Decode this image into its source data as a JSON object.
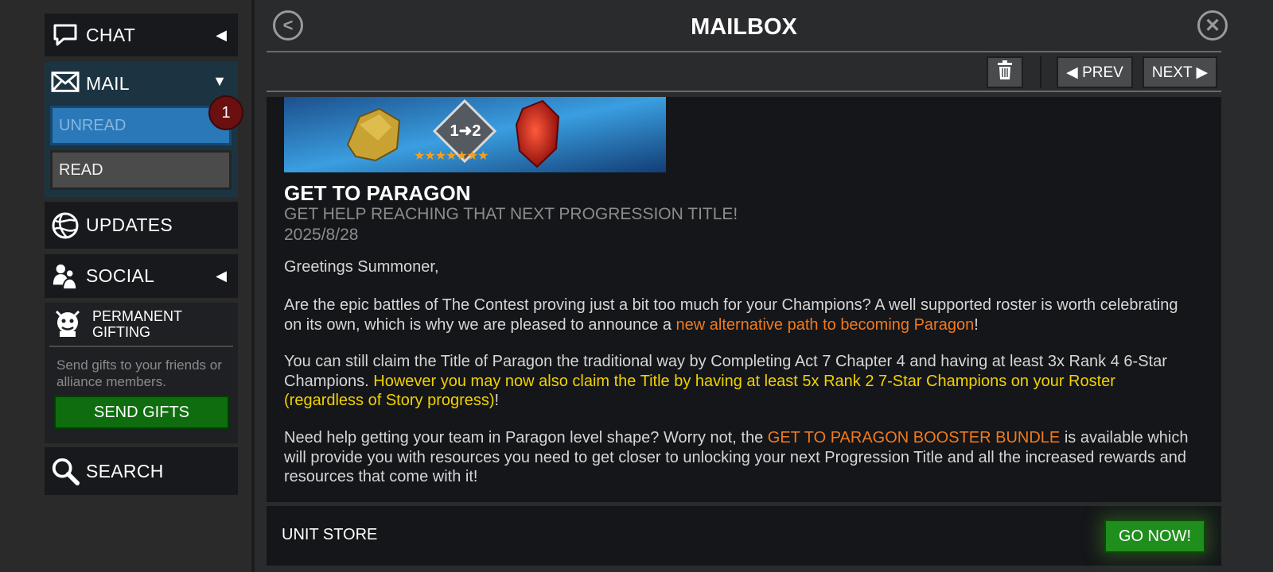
{
  "sidebar": {
    "chat": {
      "label": "CHAT"
    },
    "mail": {
      "label": "MAIL",
      "unread_label": "UNREAD",
      "read_label": "READ",
      "unread_count": "1"
    },
    "updates": {
      "label": "UPDATES"
    },
    "social": {
      "label": "SOCIAL"
    },
    "gifting": {
      "title": "PERMANENT GIFTING",
      "description": "Send gifts to your friends or alliance members.",
      "button": "SEND GIFTS"
    },
    "search": {
      "label": "SEARCH"
    }
  },
  "header": {
    "title": "MAILBOX",
    "prev_label": "◀ PREV",
    "next_label": "NEXT ▶"
  },
  "message": {
    "banner": {
      "rank_change": "1➜2",
      "stars": "★★★★★★★"
    },
    "heading": "GET TO PARAGON",
    "subheading": "GET HELP REACHING THAT NEXT PROGRESSION TITLE!",
    "date": "2025/8/28",
    "greeting": "Greetings Summoner,",
    "p1_text": "Are the epic battles of The Contest proving just a bit too much for your Champions? A well supported roster is worth celebrating on its own, which is why we are pleased to announce a ",
    "p1_link": "new alternative path to becoming Paragon",
    "p1_end": "!",
    "p2_text": "You can still claim the Title of Paragon the traditional way by Completing Act 7 Chapter 4 and having at least 3x Rank 4 6-Star Champions. ",
    "p2_highlight": "However you may now also claim the Title by having at least 5x Rank 2 7-Star Champions on your Roster (regardless of Story progress)",
    "p2_end": "!",
    "p3_text": "Need help getting your team in Paragon level shape? Worry not, the ",
    "p3_link": "GET TO PARAGON BOOSTER BUNDLE",
    "p3_end": " is available which will provide you with resources you need to get closer to unlocking your next Progression Title and all the increased rewards and resources that come with it!"
  },
  "footer": {
    "label": "UNIT STORE",
    "button": "GO NOW!"
  },
  "colors": {
    "background": "#2a2b2d",
    "panel": "#141619",
    "unread_blue": "#2a78b8",
    "link_orange": "#f07a1e",
    "highlight_yellow": "#f2d200",
    "action_green": "#1f8e1c"
  },
  "icons": {
    "chat": "speech-bubble-icon",
    "mail": "envelope-icon",
    "updates": "globe-icon",
    "social": "people-icon",
    "gifting": "gifting-mascot-icon",
    "search": "magnifier-icon",
    "trash": "trash-icon",
    "back": "back-arrow-icon",
    "close": "close-icon"
  }
}
